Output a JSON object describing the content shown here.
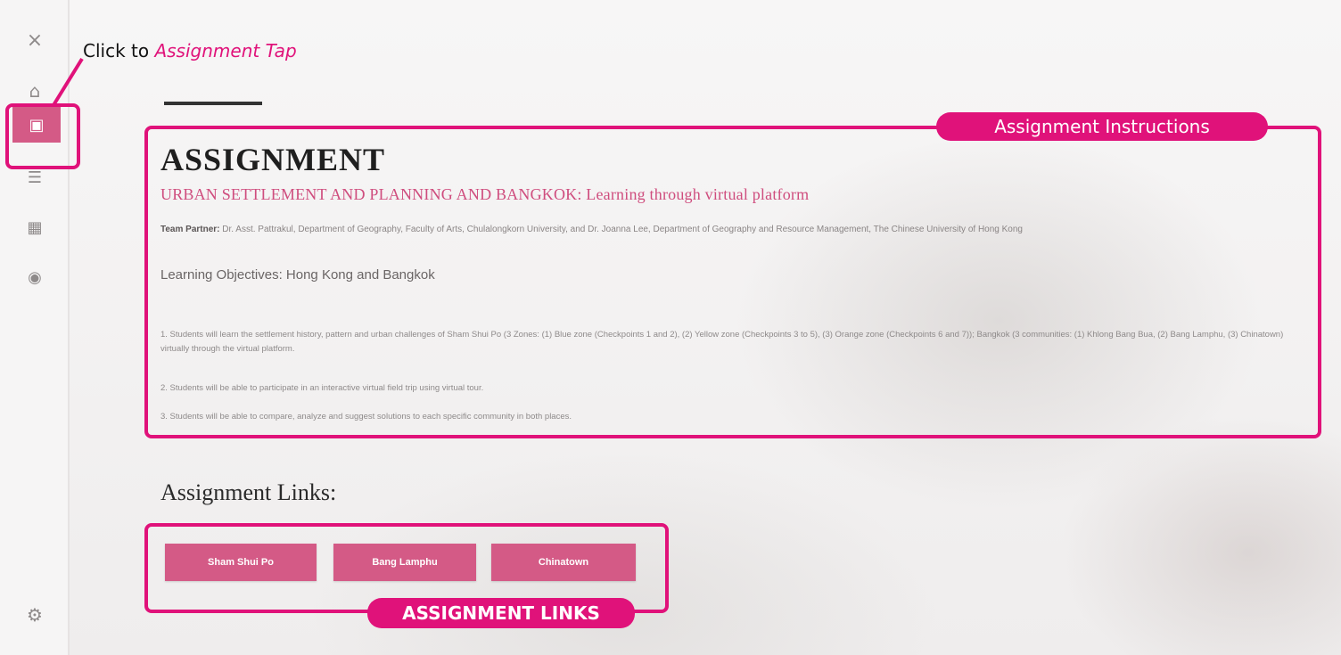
{
  "sidebar": {
    "close_icon": "×",
    "home_icon": "⌂",
    "assignment_icon": "▣",
    "list_icon": "☰",
    "map_icon": "▦",
    "vr_icon": "◉",
    "settings_icon": "⚙"
  },
  "callout": {
    "prefix": "Click to ",
    "emphasis": "Assignment Tap"
  },
  "labels": {
    "instructions": "Assignment Instructions",
    "links": "ASSIGNMENT LINKS"
  },
  "assignment": {
    "title": "ASSIGNMENT",
    "subtitle_caps": "URBAN SETTLEMENT AND PLANNING AND BANGKOK:",
    "subtitle_rest": " Learning through virtual platform",
    "team_label": "Team Partner:",
    "team_text": " Dr. Asst. Pattrakul, Department of Geography, Faculty of Arts, Chulalongkorn University, and Dr. Joanna Lee, Department of Geography and Resource Management, The Chinese University of Hong Kong",
    "objectives_heading": "Learning Objectives: Hong Kong and Bangkok",
    "objectives": [
      "1.   Students will learn the settlement history, pattern and urban challenges of Sham Shui Po (3 Zones: (1) Blue zone (Checkpoints 1 and 2), (2) Yellow zone (Checkpoints 3 to 5), (3) Orange zone (Checkpoints 6 and 7)); Bangkok (3 communities: (1) Khlong Bang Bua, (2) Bang Lamphu, (3) Chinatown) virtually through the virtual platform.",
      "2.   Students will be able to participate in an interactive virtual field trip using virtual tour.",
      "3.   Students will be able to compare, analyze and suggest solutions to each specific community in both places."
    ]
  },
  "links": {
    "heading": "Assignment Links:",
    "buttons": [
      "Sham Shui Po",
      "Bang Lamphu",
      "Chinatown"
    ]
  },
  "colors": {
    "highlight": "#e0127a",
    "button": "#d45a86",
    "subtitle": "#cf4d7e"
  }
}
